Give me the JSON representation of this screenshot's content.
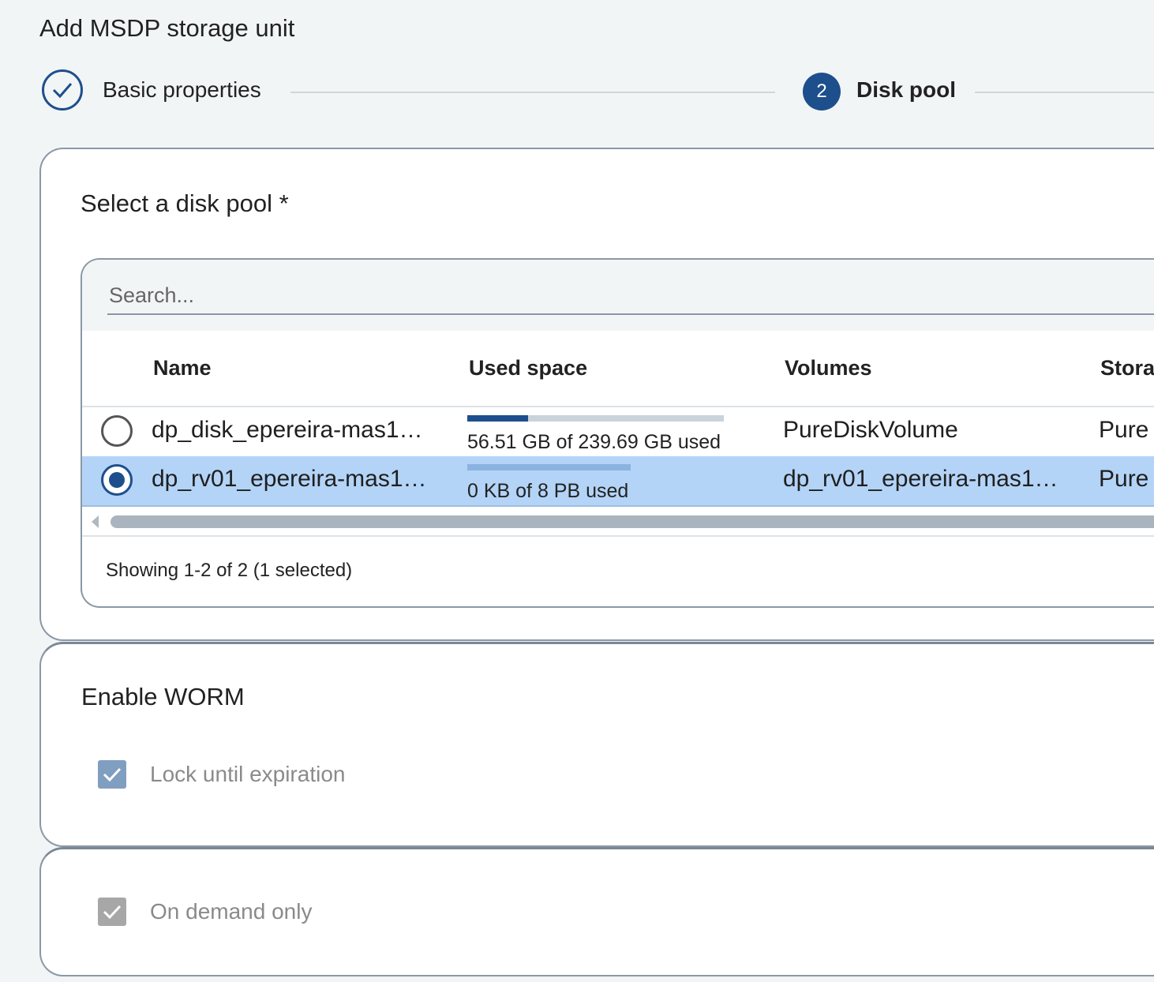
{
  "page": {
    "title": "Add MSDP storage unit"
  },
  "stepper": {
    "steps": [
      {
        "label": "Basic properties",
        "state": "completed",
        "icon": "check-icon"
      },
      {
        "number": "2",
        "label": "Disk pool",
        "state": "active"
      }
    ]
  },
  "disk_pool_section": {
    "title": "Select a disk pool *",
    "search": {
      "placeholder": "Search...",
      "value": ""
    },
    "columns": [
      "Name",
      "Used space",
      "Volumes",
      "Storag"
    ],
    "rows": [
      {
        "selected": false,
        "name": "dp_disk_epereira-mas1…",
        "used_space_text": "56.51 GB of 239.69 GB used",
        "used_fraction": 0.236,
        "volumes": "PureDiskVolume",
        "storage": "Pure"
      },
      {
        "selected": true,
        "name": "dp_rv01_epereira-mas1…",
        "used_space_text": "0 KB of 8 PB used",
        "used_fraction": 0.0,
        "volumes": "dp_rv01_epereira-mas1…",
        "storage": "Pure"
      }
    ],
    "footer": "Showing 1-2 of 2 (1 selected)"
  },
  "worm_section": {
    "title": "Enable WORM",
    "lock_until_expiration": {
      "label": "Lock until expiration",
      "checked": true,
      "disabled": true
    }
  },
  "on_demand_section": {
    "on_demand_only": {
      "label": "On demand only",
      "checked": true,
      "disabled": true
    }
  },
  "colors": {
    "accent": "#1d4f8c",
    "selected_row": "#b3d4f7",
    "page_bg": "#f2f5f6",
    "bar_track": "#c9d3dc",
    "bar_selected": "#8ab3e0"
  }
}
